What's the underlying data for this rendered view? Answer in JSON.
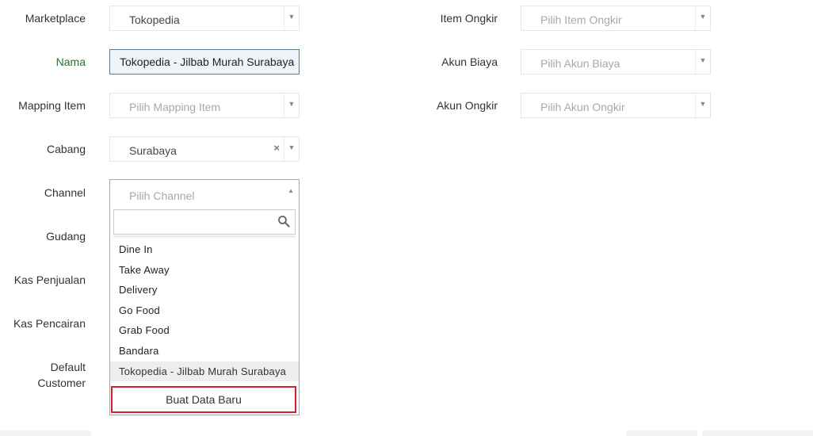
{
  "left_form": {
    "marketplace": {
      "label": "Marketplace",
      "value": "Tokopedia"
    },
    "nama": {
      "label": "Nama",
      "value": "Tokopedia - Jilbab Murah Surabaya"
    },
    "mapping_item": {
      "label": "Mapping Item",
      "placeholder": "Pilih Mapping Item"
    },
    "cabang": {
      "label": "Cabang",
      "value": "Surabaya",
      "clear": "×"
    },
    "channel": {
      "label": "Channel",
      "placeholder": "Pilih Channel"
    },
    "gudang": {
      "label": "Gudang"
    },
    "kas_penjualan": {
      "label": "Kas Penjualan"
    },
    "kas_pencairan": {
      "label": "Kas Pencairan"
    },
    "default_customer": {
      "label_line1": "Default",
      "label_line2": "Customer"
    }
  },
  "right_form": {
    "item_ongkir": {
      "label": "Item Ongkir",
      "placeholder": "Pilih Item Ongkir"
    },
    "akun_biaya": {
      "label": "Akun Biaya",
      "placeholder": "Pilih Akun Biaya"
    },
    "akun_ongkir": {
      "label": "Akun Ongkir",
      "placeholder": "Pilih Akun Ongkir"
    }
  },
  "channel_dropdown": {
    "search_value": "",
    "options": [
      "Dine In",
      "Take Away",
      "Delivery",
      "Go Food",
      "Grab Food",
      "Bandara",
      "Tokopedia - Jilbab Murah Surabaya"
    ],
    "highlighted_index": 6,
    "create_button_label": "Buat Data Baru"
  },
  "icons": {
    "dropdown_arrow": "▼",
    "dropdown_arrow_up": "▲",
    "search": "search-icon"
  },
  "colors": {
    "highlight_border": "#d32027",
    "input_border": "#5c7d8c",
    "label_green": "#2e6b3a"
  }
}
